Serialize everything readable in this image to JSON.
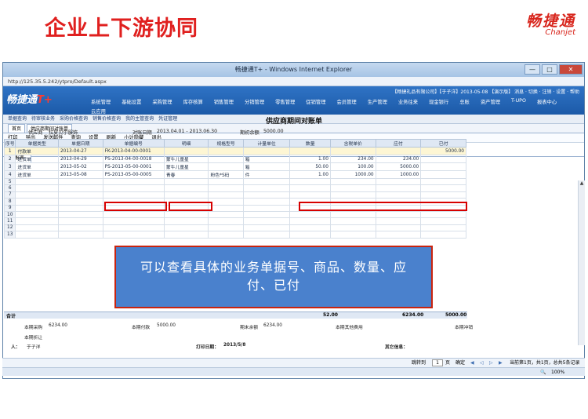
{
  "slide": {
    "title": "企业上下游协同"
  },
  "logo": {
    "cn": "畅捷通",
    "en": "Chanjet"
  },
  "browser": {
    "window_title": "畅捷通T+ - Windows Internet Explorer",
    "address": "http://125.35.5.242/ytpro/Default.aspx",
    "minimize": "—",
    "maximize": "□",
    "close": "✕"
  },
  "app": {
    "logo_text": "畅捷通",
    "logo_suffix": "T+",
    "userbar": "【畅捷礼品有限公司】【于子洋】2013-05-08 【演示版】 消息 · 切换 · 注销 · 设置 · 帮助",
    "menu": [
      "系统管理",
      "基础设置",
      "采购管理",
      "库存核算",
      "销售管理",
      "分销管理",
      "零售管理",
      "促销管理",
      "会员管理",
      "生产管理",
      "业务往来",
      "现金银行",
      "总账",
      "资产管理",
      "T-UPO",
      "报表中心"
    ],
    "menu2": "云应用"
  },
  "quicklinks": [
    "单据查询",
    "待审核业务",
    "采购价格查询",
    "销售价格查询",
    "我的主管查询",
    "凭证管理"
  ],
  "tabs": [
    "首页",
    "供应商期间对账单"
  ],
  "toolbar": [
    "打印",
    "导出",
    "发送邮件",
    "查询",
    "设置",
    "刷新",
    "小计隐藏",
    "退出"
  ],
  "subtab": "报表",
  "report": {
    "title": "供应商期间对账单",
    "supplier_label": "供应商",
    "supplier": "拉夏贝尔服饰",
    "date_label": "对账日期",
    "date": "2013.04.01 - 2013.06.30",
    "opening_label": "期初余额",
    "opening": "5000.00",
    "columns": [
      "序号",
      "单据类型",
      "单据日期",
      "单据编号",
      "明细",
      "规格型号",
      "计量单位",
      "数量",
      "含税单价",
      "应付",
      "已付"
    ],
    "rows": [
      [
        "1",
        "付款单",
        "2013-04-27",
        "FK-2013-04-00-0001",
        "",
        "",
        "",
        "",
        "",
        "",
        "5000.00"
      ],
      [
        "2",
        "进货单",
        "2013-04-29",
        "PS-2013-04-00-0018",
        "蒙牛儿童星",
        "",
        "箱",
        "1.00",
        "234.00",
        "234.00",
        ""
      ],
      [
        "3",
        "进货单",
        "2013-05-02",
        "PS-2013-05-00-0001",
        "蒙牛儿童星",
        "",
        "箱",
        "50.00",
        "100.00",
        "5000.00",
        ""
      ],
      [
        "4",
        "进货单",
        "2013-05-08",
        "PS-2013-05-00-0005",
        "青春",
        "粉色*S码",
        "件",
        "1.00",
        "1000.00",
        "1000.00",
        ""
      ],
      [
        "5",
        "",
        "",
        "",
        "",
        "",
        "",
        "",
        "",
        "",
        ""
      ],
      [
        "6",
        "",
        "",
        "",
        "",
        "",
        "",
        "",
        "",
        "",
        ""
      ],
      [
        "7",
        "",
        "",
        "",
        "",
        "",
        "",
        "",
        "",
        "",
        ""
      ],
      [
        "8",
        "",
        "",
        "",
        "",
        "",
        "",
        "",
        "",
        "",
        ""
      ],
      [
        "9",
        "",
        "",
        "",
        "",
        "",
        "",
        "",
        "",
        "",
        ""
      ],
      [
        "10",
        "",
        "",
        "",
        "",
        "",
        "",
        "",
        "",
        "",
        ""
      ],
      [
        "11",
        "",
        "",
        "",
        "",
        "",
        "",
        "",
        "",
        "",
        ""
      ],
      [
        "12",
        "",
        "",
        "",
        "",
        "",
        "",
        "",
        "",
        "",
        ""
      ],
      [
        "13",
        "",
        "",
        "",
        "",
        "",
        "",
        "",
        "",
        "",
        ""
      ]
    ],
    "total_label": "合计",
    "total_qty": "52.00",
    "total_payable": "6234.00",
    "total_paid": "5000.00"
  },
  "callout": {
    "line1": "可以查看具体的业务单据号、商品、数量、应",
    "line2": "付、已付"
  },
  "summary": {
    "purchase_label": "本期采购",
    "purchase": "6234.00",
    "paid_label": "本期付款",
    "paid": "5000.00",
    "closing_label": "期末余额",
    "closing": "6234.00",
    "other_label": "本期其他费用",
    "writeoff_label": "本期冲销",
    "discount_label": "本期折让",
    "person_label": "人：",
    "person": "于子洋",
    "print_date_label": "打印日期：",
    "print_date": "2013/5/8",
    "other_info_label": "其它信息："
  },
  "pager": {
    "goto_label": "跳转到",
    "page": "1",
    "page_unit": "页",
    "confirm": "确定",
    "info": "当前第1页，共1页，总共5条记录"
  },
  "status": {
    "zoom": "100%"
  }
}
